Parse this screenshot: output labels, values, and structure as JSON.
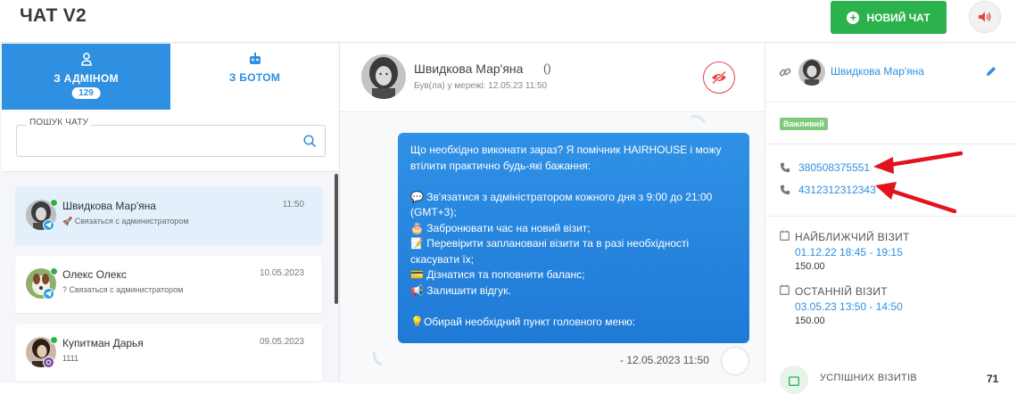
{
  "header": {
    "title": "ЧАТ V2",
    "new_chat_label": "НОВИЙ ЧАТ",
    "sound_icon": "speaker-icon"
  },
  "tabs": [
    {
      "label": "З АДМІНОМ",
      "badge": "129",
      "icon": "user-group-icon",
      "active": true
    },
    {
      "label": "З БОТОМ",
      "icon": "robot-icon",
      "active": false
    }
  ],
  "search": {
    "label": "ПОШУК ЧАТУ",
    "value": "",
    "placeholder": ""
  },
  "chats": [
    {
      "name": "Швидкова Мар'яна",
      "time": "11:50",
      "preview": "🚀 Связаться с администратором",
      "channel": "telegram",
      "online": true,
      "active": true
    },
    {
      "name": "Олекс Олекс",
      "time": "10.05.2023",
      "preview": "? Связаться с администратором",
      "channel": "telegram",
      "online": true,
      "active": false
    },
    {
      "name": "Купитман Дарья",
      "time": "09.05.2023",
      "preview": "1111",
      "channel": "viber",
      "online": true,
      "active": false
    }
  ],
  "conversation": {
    "contact_name": "Швидкова Мар'яна",
    "contact_extra": "()",
    "status": "Був(ла) у мережі: 12.05.23 11:50",
    "message_lines": [
      "Що необхідно виконати зараз? Я помічник HAIRHOUSE і можу",
      "втілити практично будь-які бажання:",
      "",
      "💬 Зв'язатися з адміністратором кожного дня з 9:00 до 21:00",
      "(GMT+3);",
      "🎂 Забронювати час на новий візит;",
      "📝 Перевірити заплановані візити та в разі необхідності",
      "скасувати їх;",
      "💳 Дізнатися та поповнити баланс;",
      "📢 Залишити відгук.",
      "",
      "💡Обирай необхідний пункт головного меню:"
    ],
    "message_meta": "-  12.05.2023 11:50"
  },
  "client": {
    "name": "Швидкова Мар'яна",
    "tag": "Важливий",
    "phones": [
      "380508375551",
      "4312312312343"
    ],
    "next_visit": {
      "title": "НАЙБЛИЖЧИЙ ВІЗИТ",
      "date": "01.12.22 18:45 - 19:15",
      "price": "150.00"
    },
    "last_visit": {
      "title": "ОСТАННІЙ ВІЗИТ",
      "date": "03.05.23 13:50 - 14:50",
      "price": "150.00"
    },
    "stat": {
      "label": "УСПІШНИХ ВІЗИТІВ",
      "value": "71"
    }
  },
  "colors": {
    "accent": "#2f8fe0",
    "success": "#2bb24c",
    "danger": "#e24545",
    "annotation_arrow": "#e3131b"
  }
}
